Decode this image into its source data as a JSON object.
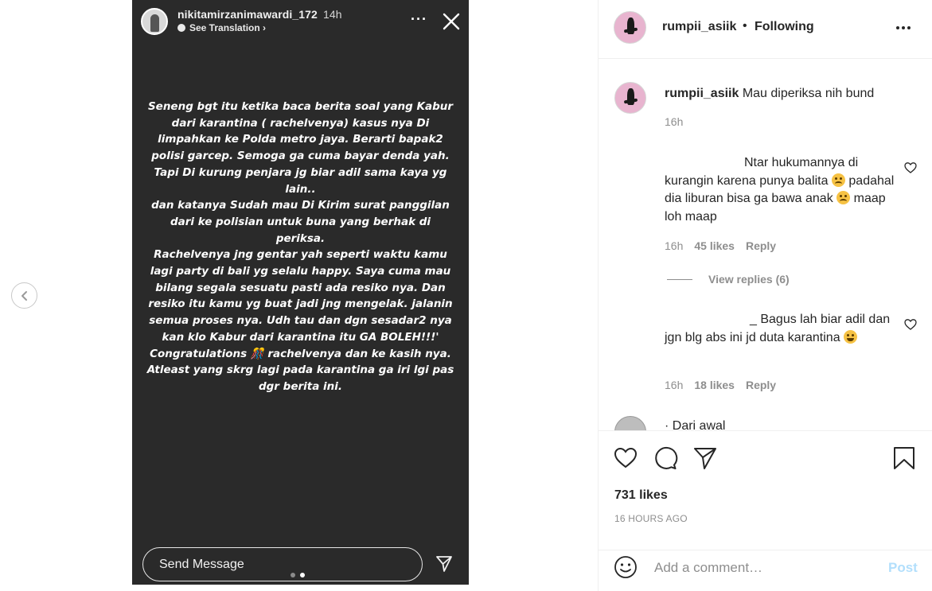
{
  "story": {
    "username": "nikitamirzanimawardi_172",
    "time": "14h",
    "see_translation": "See Translation ›",
    "more": "···",
    "paragraphs": [
      "Seneng bgt itu ketika baca berita soal yang Kabur dari karantina ( rachelvenya) kasus nya Di limpahkan ke Polda metro jaya. Berarti bapak2 polisi garcep. Semoga ga cuma bayar denda yah. Tapi Di kurung penjara jg biar adil sama kaya yg lain..",
      "dan katanya Sudah mau Di Kirim surat panggilan dari ke polisian untuk buna yang berhak di periksa.",
      "Rachelvenya jng gentar yah seperti waktu kamu lagi party di bali yg selalu happy. Saya cuma mau bilang segala sesuatu pasti ada resiko nya. Dan resiko itu kamu yg buat jadi jng mengelak. jalanin semua proses nya. Udh tau dan dgn sesadar2 nya kan klo Kabur dari karantina itu GA BOLEH!!!'",
      "Congratulations 🎊 rachelvenya dan ke kasih nya. Atleast yang skrg lagi pada karantina ga iri lgi pas dgr berita ini."
    ],
    "send_message": "Send Message"
  },
  "header": {
    "username": "rumpii_asiik",
    "separator": "•",
    "follow_status": "Following"
  },
  "caption": {
    "username": "rumpii_asiik",
    "text": "Mau diperiksa nih bund",
    "time": "16h"
  },
  "comments": [
    {
      "text_a": "Ntar hukumannya di kurangin karena punya balita",
      "text_b": "padahal dia liburan bisa ga bawa anak",
      "text_c": "maap loh maap",
      "time": "16h",
      "likes": "45 likes",
      "reply": "Reply"
    },
    {
      "text_a": "_ Bagus lah biar adil dan jgn blg abs ini jd duta karantina",
      "time": "16h",
      "likes": "18 likes",
      "reply": "Reply"
    }
  ],
  "view_replies": "View replies (6)",
  "partial_comment": "· Dari awal",
  "post_stats": {
    "likes": "731 likes",
    "timestamp": "16 HOURS AGO"
  },
  "comment_box": {
    "placeholder": "Add a comment…",
    "post_label": "Post"
  },
  "colors": {
    "story_bg": "#2a2a2a",
    "post_button": "#b2dffc",
    "secondary_text": "#8e8e8e",
    "avatar_bg": "#e8b4cf"
  },
  "icons": [
    "chevron-left-icon",
    "close-icon",
    "more-icon",
    "send-icon",
    "heart-icon",
    "comment-icon",
    "share-icon",
    "bookmark-icon",
    "smile-icon",
    "globe-icon"
  ]
}
